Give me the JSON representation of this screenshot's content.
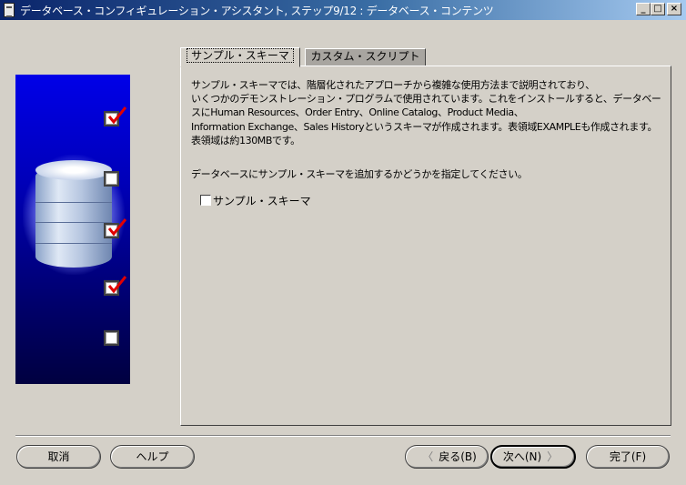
{
  "window": {
    "title": "データベース・コンフィギュレーション・アシスタント, ステップ9/12 : データベース・コンテンツ",
    "minimize_label": "_",
    "maximize_label": "□",
    "close_label": "×"
  },
  "tabs": [
    {
      "label": "サンプル・スキーマ",
      "active": true
    },
    {
      "label": "カスタム・スクリプト",
      "active": false
    }
  ],
  "content": {
    "description": "サンプル・スキーマでは、階層化されたアプローチから複雑な使用方法まで説明されており、\nいくつかのデモンストレーション・プログラムで使用されています。これをインストールすると、データベースにHuman Resources、Order Entry、Online Catalog、Product Media、\nInformation Exchange、Sales Historyというスキーマが作成されます。表領域EXAMPLEも作成されます。表領域は約130MBです。",
    "prompt": "データベースにサンプル・スキーマを追加するかどうかを指定してください。",
    "checkbox_label": "サンプル・スキーマ",
    "checkbox_checked": false
  },
  "wizard_steps": [
    {
      "checked": true
    },
    {
      "checked": false
    },
    {
      "checked": true
    },
    {
      "checked": true
    },
    {
      "checked": false
    }
  ],
  "buttons": {
    "cancel": "取消",
    "help": "ヘルプ",
    "back": "戻る(B)",
    "next": "次へ(N)",
    "finish": "完了(F)"
  },
  "icons": {
    "back": "chevron-left-icon",
    "next": "chevron-right-icon"
  },
  "colors": {
    "titlebar_start": "#0a246a",
    "titlebar_end": "#a6caf0",
    "panel_blue": "#0000e8",
    "checkmark_red": "#e00000",
    "face": "#d4d0c8"
  }
}
